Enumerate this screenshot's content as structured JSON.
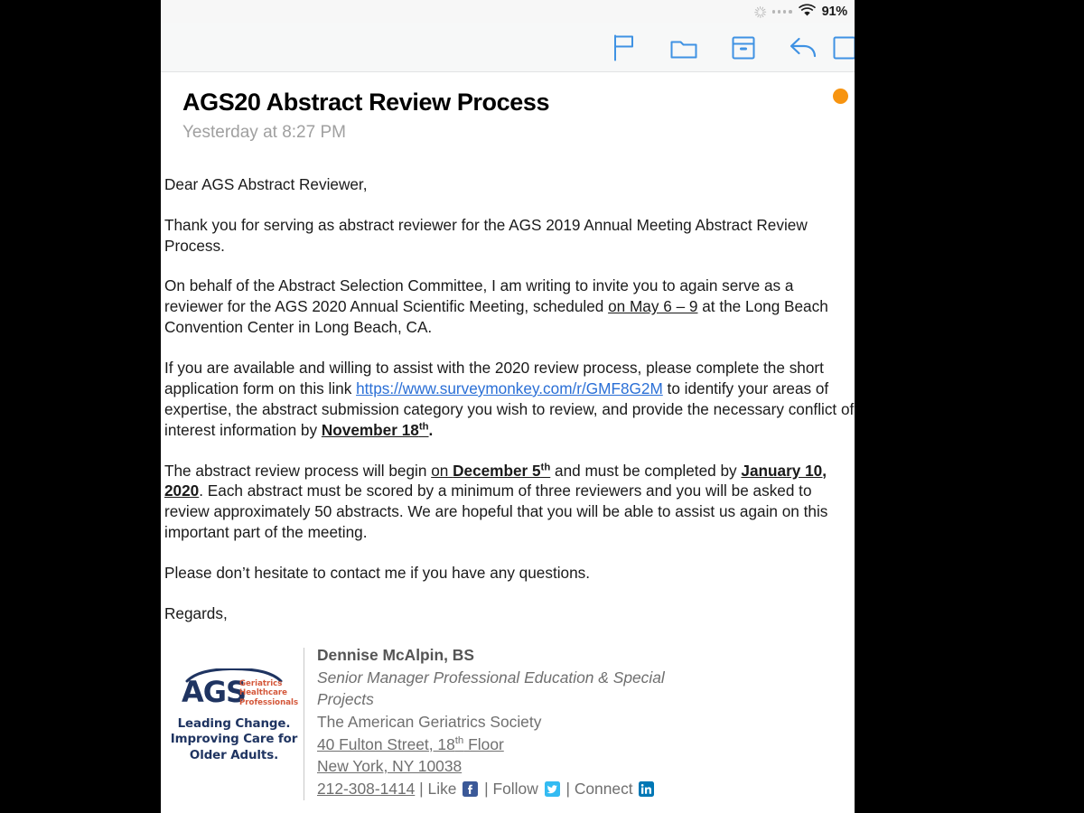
{
  "statusbar": {
    "spinner_icon": "activity-spinner-icon",
    "signal_icon": "signal-dots-icon",
    "wifi_icon": "wifi-icon",
    "battery": "91%"
  },
  "toolbar": {
    "buttons": [
      {
        "name": "flag-button",
        "icon": "flag-icon",
        "label": "Flag"
      },
      {
        "name": "move-to-folder-button",
        "icon": "folder-icon",
        "label": "Move to Folder"
      },
      {
        "name": "archive-button",
        "icon": "archive-box-icon",
        "label": "Archive"
      },
      {
        "name": "reply-button",
        "icon": "reply-arrow-icon",
        "label": "Reply"
      },
      {
        "name": "compose-button",
        "icon": "compose-icon",
        "label": "Compose"
      }
    ]
  },
  "message": {
    "title": "AGS20 Abstract Review Process",
    "date": "Yesterday at 8:27 PM",
    "unread_dot_color": "#f79410",
    "link_color": "#2a6fd6",
    "salutation": "Dear AGS Abstract Reviewer,",
    "paragraph_1": "Thank you for serving as abstract reviewer for the AGS 2019 Annual Meeting Abstract Review Process.",
    "paragraph_2_a": "On behalf of the Abstract Selection Committee, I am writing to invite you to again serve as a reviewer for the AGS 2020 Annual Scientific Meeting, scheduled ",
    "paragraph_2_dates": "on May 6 – 9",
    "paragraph_2_b": " at the Long Beach Convention Center in Long Beach, CA.",
    "paragraph_3_a": "If you are available and willing to assist with the 2020 review process,  please complete the short application form on this link ",
    "paragraph_3_link": "https://www.surveymonkey.com/r/GMF8G2M",
    "paragraph_3_b": " to identify your areas of expertise, the abstract submission category you wish to review, and provide the necessary conflict of interest information by ",
    "paragraph_3_deadline": "November 18",
    "paragraph_3_deadline_sup": "th",
    "paragraph_3_c": ".",
    "paragraph_4_a": "The abstract review process will begin ",
    "paragraph_4_start_prefix": "on ",
    "paragraph_4_start": "December 5",
    "paragraph_4_start_sup": "th",
    "paragraph_4_b": " and must be completed by ",
    "paragraph_4_end": "January 10, 2020",
    "paragraph_4_c": ".  Each abstract must be scored by a minimum of three reviewers and you will be asked to review approximately 50 abstracts. We are hopeful that you will be able to assist us again on this important part of the meeting.",
    "paragraph_5": "Please don’t hesitate to contact me if you have any questions.",
    "closing": "Regards,"
  },
  "signature": {
    "logo": {
      "acronym": "AGS",
      "sub_line_1": "Geriatrics",
      "sub_line_2": "Healthcare",
      "sub_line_3": "Professionals",
      "tagline_1": "Leading Change.",
      "tagline_2": "Improving Care for",
      "tagline_3": "Older Adults.",
      "navy": "#1f3461",
      "orange": "#d4573a"
    },
    "name": "Dennise McAlpin, BS",
    "title_line_1": "Senior Manager Professional Education & Special",
    "title_line_2": "Projects",
    "organization": "The American Geriatrics Society",
    "address_street": "40 Fulton Street, 18",
    "address_street_sup": "th",
    "address_street_suffix": " Floor",
    "address_city": "New York, NY 10038",
    "phone": "212-308-1414",
    "social": {
      "separator": "|",
      "like_label": "Like",
      "facebook_icon": "facebook-icon",
      "follow_label": "Follow",
      "twitter_icon": "twitter-icon",
      "connect_label": "Connect",
      "linkedin_icon": "linkedin-icon"
    }
  }
}
